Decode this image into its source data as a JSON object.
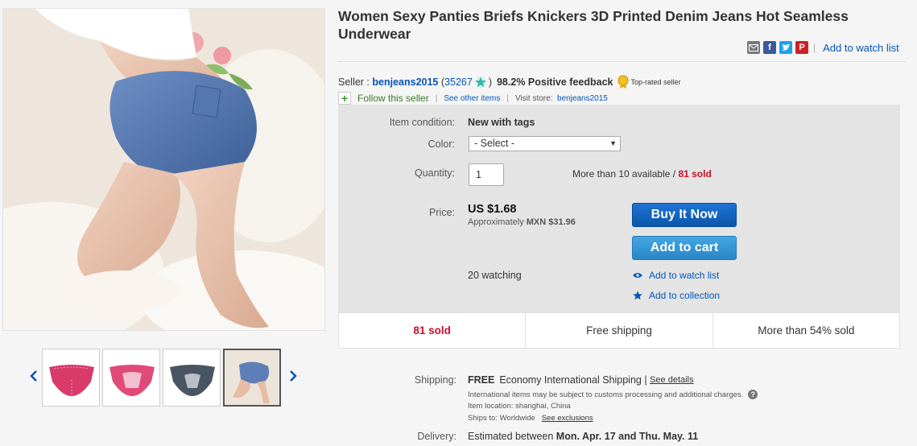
{
  "title": "Women Sexy Panties Briefs Knickers 3D Printed Denim Jeans Hot Seamless Underwear",
  "header": {
    "add_watch_label": "Add to watch list",
    "social_icons": [
      "email-icon",
      "facebook-icon",
      "twitter-icon",
      "pinterest-icon"
    ]
  },
  "seller": {
    "label": "Seller :",
    "name": "benjeans2015",
    "score_open": "(",
    "score": "35267",
    "score_close": ")",
    "feedback": "98.2% Positive feedback",
    "top_rated": "Top-rated seller",
    "follow": "Follow this seller",
    "see_other": "See other items",
    "visit_store_label": "Visit store:",
    "store_name": "benjeans2015"
  },
  "item": {
    "condition_label": "Item condition:",
    "condition": "New with tags",
    "color_label": "Color:",
    "color_value": "- Select -",
    "quantity_label": "Quantity:",
    "quantity": "1",
    "available": "More than 10 available",
    "avail_sep": "/",
    "sold": "81 sold",
    "price_label": "Price:",
    "price": "US $1.68",
    "approx_prefix": "Approximately",
    "approx_value": "MXN $31.96",
    "buy_now": "Buy It Now",
    "add_to_cart": "Add to cart",
    "watching": "20 watching",
    "add_watch": "Add to watch list",
    "add_collection": "Add to collection"
  },
  "stats": [
    "81 sold",
    "Free shipping",
    "More than 54% sold"
  ],
  "shipping": {
    "label": "Shipping:",
    "free": "FREE",
    "method": "Economy International Shipping",
    "pipe": "|",
    "see_details": "See details",
    "customs_note": "International items may be subject to customs processing and additional charges.",
    "location_label": "Item location:",
    "location": "shanghai, China",
    "ships_to_label": "Ships to:",
    "ships_to": "Worldwide",
    "see_exclusions": "See exclusions"
  },
  "delivery": {
    "label": "Delivery:",
    "prefix": "Estimated between",
    "range": "Mon. Apr. 17 and Thu. May. 11"
  },
  "colors": {
    "link": "#0654ba",
    "buy_now": "#0b56ab",
    "add_cart": "#2a86c7",
    "sold_red": "#c8102e",
    "panel_bg": "#e4e4e4",
    "follow_green": "#3a7d23"
  }
}
